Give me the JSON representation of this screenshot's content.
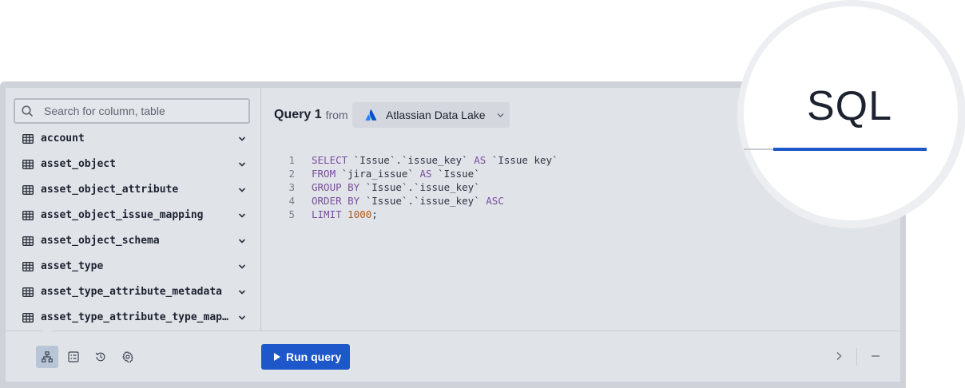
{
  "search": {
    "placeholder": "Search for column, table"
  },
  "tables": [
    {
      "name": "account"
    },
    {
      "name": "asset_object"
    },
    {
      "name": "asset_object_attribute"
    },
    {
      "name": "asset_object_issue_mapping"
    },
    {
      "name": "asset_object_schema"
    },
    {
      "name": "asset_type"
    },
    {
      "name": "asset_type_attribute_metadata"
    },
    {
      "name": "asset_type_attribute_type_mapping"
    }
  ],
  "query": {
    "title": "Query 1",
    "from_label": "from",
    "source": "Atlassian Data Lake",
    "source_icon": "atlassian-logo-icon"
  },
  "code_lines": [
    {
      "num": "1",
      "parts": [
        {
          "t": "SELECT",
          "c": "kw"
        },
        {
          "t": " `Issue`.`issue_key` ",
          "c": "id"
        },
        {
          "t": "AS",
          "c": "kw"
        },
        {
          "t": " `Issue key`",
          "c": "id"
        }
      ]
    },
    {
      "num": "2",
      "parts": [
        {
          "t": "FROM",
          "c": "kw"
        },
        {
          "t": " `jira_issue` ",
          "c": "id"
        },
        {
          "t": "AS",
          "c": "kw"
        },
        {
          "t": " `Issue`",
          "c": "id"
        }
      ]
    },
    {
      "num": "3",
      "parts": [
        {
          "t": "GROUP BY",
          "c": "kw"
        },
        {
          "t": " `Issue`.`issue_key`",
          "c": "id"
        }
      ]
    },
    {
      "num": "4",
      "parts": [
        {
          "t": "ORDER BY",
          "c": "kw"
        },
        {
          "t": " `Issue`.`issue_key` ",
          "c": "id"
        },
        {
          "t": "ASC",
          "c": "kw"
        }
      ]
    },
    {
      "num": "5",
      "parts": [
        {
          "t": "LIMIT",
          "c": "kw"
        },
        {
          "t": " ",
          "c": "id"
        },
        {
          "t": "1000",
          "c": "num"
        },
        {
          "t": ";",
          "c": "id"
        }
      ]
    }
  ],
  "toolbar": {
    "run_label": "Run query",
    "tools": [
      "schema-icon",
      "table-view-icon",
      "history-icon",
      "settings-icon"
    ],
    "active_tool": "schema-icon"
  },
  "zoom": {
    "label": "SQL"
  },
  "colors": {
    "accent": "#1e57c9",
    "keyword": "#7a4d9c",
    "number": "#b05a1a"
  }
}
